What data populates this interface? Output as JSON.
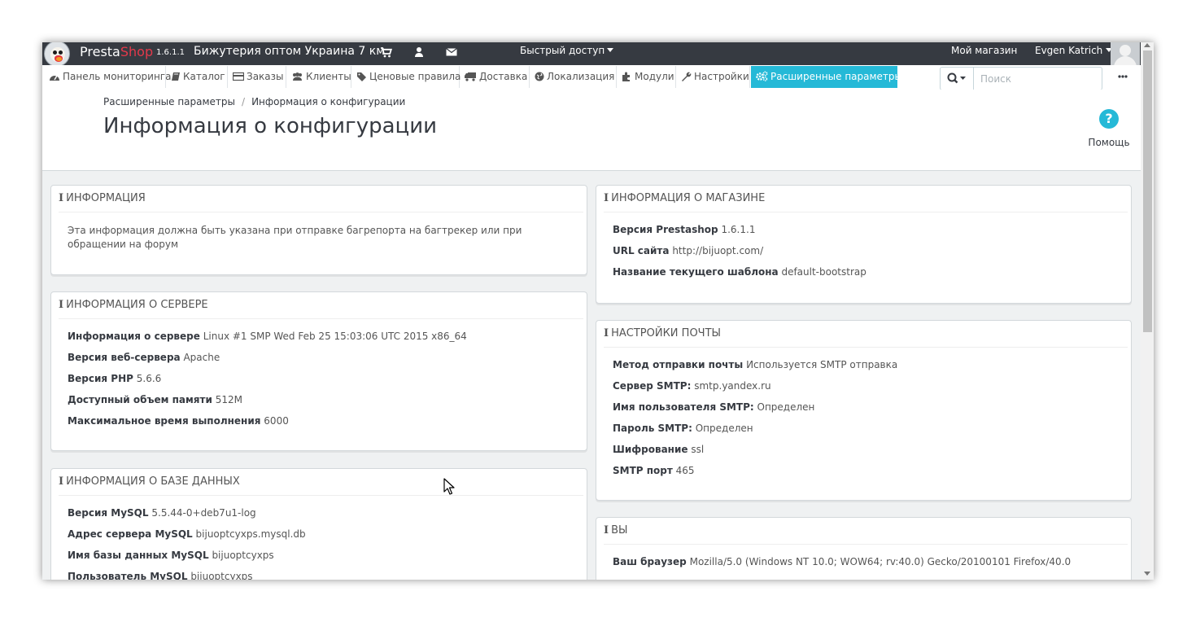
{
  "topbar": {
    "brand_presta": "Presta",
    "brand_shop": "Shop",
    "version": "1.6.1.1",
    "shop_name": "Бижутерия оптом Украина 7 км",
    "quick_access": "Быстрый доступ",
    "my_shop": "Мой магазин",
    "user_name": "Evgen Katrich"
  },
  "nav": {
    "items": [
      {
        "label": "Панель мониторинга",
        "icon": "dashboard-icon"
      },
      {
        "label": "Каталог",
        "icon": "book-icon"
      },
      {
        "label": "Заказы",
        "icon": "credit-card-icon"
      },
      {
        "label": "Клиенты",
        "icon": "users-icon"
      },
      {
        "label": "Ценовые правила",
        "icon": "tag-icon"
      },
      {
        "label": "Доставка",
        "icon": "truck-icon"
      },
      {
        "label": "Локализация",
        "icon": "globe-icon"
      },
      {
        "label": "Модули",
        "icon": "puzzle-icon"
      },
      {
        "label": "Настройки",
        "icon": "wrench-icon"
      },
      {
        "label": "Расширенные параметры",
        "icon": "cogs-icon"
      }
    ],
    "search_placeholder": "Поиск",
    "active_color": "#25b9d7"
  },
  "header": {
    "breadcrumb_parent": "Расширенные параметры",
    "breadcrumb_sep": "/",
    "breadcrumb_current": "Информация о конфигурации",
    "title": "Информация о конфигурации",
    "help_label": "Помощь"
  },
  "panels": {
    "info": {
      "title": "Информация",
      "text": "Эта информация должна быть указана при отправке багрепорта на багтрекер или при обращении на форум"
    },
    "server": {
      "title": "Информация о сервере",
      "rows": [
        {
          "label": "Информация о сервере",
          "value": "Linux #1 SMP Wed Feb 25 15:03:06 UTC 2015 x86_64"
        },
        {
          "label": "Версия веб-сервера",
          "value": "Apache"
        },
        {
          "label": "Версия PHP",
          "value": "5.6.6"
        },
        {
          "label": "Доступный объем памяти",
          "value": "512M"
        },
        {
          "label": "Максимальное время выполнения",
          "value": "6000"
        }
      ]
    },
    "database": {
      "title": "Информация о базе данных",
      "rows": [
        {
          "label": "Версия MySQL",
          "value": "5.5.44-0+deb7u1-log"
        },
        {
          "label": "Адрес сервера MySQL",
          "value": "bijuoptcyxps.mysql.db"
        },
        {
          "label": "Имя базы данных MySQL",
          "value": "bijuoptcyxps"
        },
        {
          "label": "Пользователь MySQL",
          "value": "bijuoptcyxps"
        }
      ]
    },
    "store": {
      "title": "Информация о магазине",
      "rows": [
        {
          "label": "Версия Prestashop",
          "value": "1.6.1.1"
        },
        {
          "label": "URL сайта",
          "value": "http://bijuopt.com/"
        },
        {
          "label": "Название текущего шаблона",
          "value": "default-bootstrap"
        }
      ]
    },
    "mail": {
      "title": "Настройки почты",
      "rows": [
        {
          "label": "Метод отправки почты",
          "value": "Используется SMTP отправка"
        },
        {
          "label": "Сервер SMTP:",
          "value": "smtp.yandex.ru"
        },
        {
          "label": "Имя пользователя SMTP:",
          "value": "Определен"
        },
        {
          "label": "Пароль SMTP:",
          "value": "Определен"
        },
        {
          "label": "Шифрование",
          "value": "ssl"
        },
        {
          "label": "SMTP порт",
          "value": "465"
        }
      ]
    },
    "you": {
      "title": "Вы",
      "rows": [
        {
          "label": "Ваш браузер",
          "value": "Mozilla/5.0 (Windows NT 10.0; WOW64; rv:40.0) Gecko/20100101 Firefox/40.0"
        }
      ]
    }
  }
}
